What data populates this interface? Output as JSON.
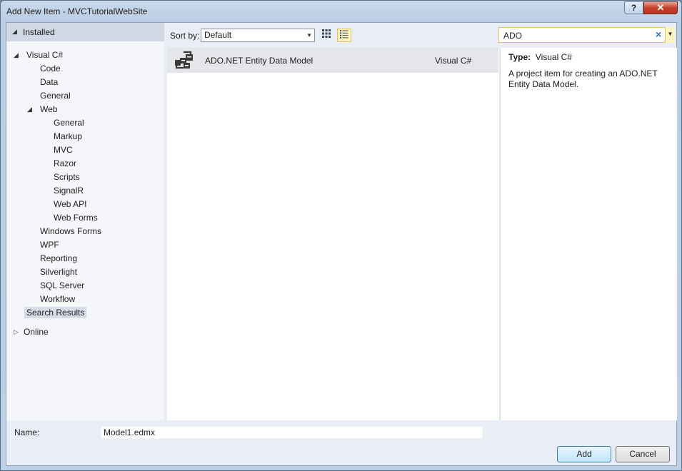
{
  "window": {
    "title": "Add New Item - MVCTutorialWebSite",
    "help_label": "?",
    "close_label": "✕"
  },
  "sidebar": {
    "installed_label": "Installed",
    "tree": [
      {
        "label": "Visual C#",
        "level": 0,
        "expanded": true
      },
      {
        "label": "Code",
        "level": 1
      },
      {
        "label": "Data",
        "level": 1
      },
      {
        "label": "General",
        "level": 1
      },
      {
        "label": "Web",
        "level": 1,
        "expanded": true
      },
      {
        "label": "General",
        "level": 2
      },
      {
        "label": "Markup",
        "level": 2
      },
      {
        "label": "MVC",
        "level": 2
      },
      {
        "label": "Razor",
        "level": 2
      },
      {
        "label": "Scripts",
        "level": 2
      },
      {
        "label": "SignalR",
        "level": 2
      },
      {
        "label": "Web API",
        "level": 2
      },
      {
        "label": "Web Forms",
        "level": 2
      },
      {
        "label": "Windows Forms",
        "level": 1
      },
      {
        "label": "WPF",
        "level": 1
      },
      {
        "label": "Reporting",
        "level": 1
      },
      {
        "label": "Silverlight",
        "level": 1
      },
      {
        "label": "SQL Server",
        "level": 1
      },
      {
        "label": "Workflow",
        "level": 1
      },
      {
        "label": "Search Results",
        "level": 0,
        "selected": true
      }
    ],
    "online_label": "Online"
  },
  "toolbar": {
    "sort_label": "Sort by:",
    "sort_value": "Default",
    "search_value": "ADO"
  },
  "items": [
    {
      "name": "ADO.NET Entity Data Model",
      "language": "Visual C#"
    }
  ],
  "details": {
    "type_label": "Type:",
    "type_value": "Visual C#",
    "description": "A project item for creating an ADO.NET Entity Data Model."
  },
  "footer": {
    "name_label": "Name:",
    "name_value": "Model1.edmx",
    "add_label": "Add",
    "cancel_label": "Cancel"
  },
  "colors": {
    "selected_row": "#e4e6e9",
    "accent_highlight": "#fdf4bf",
    "accent_border": "#e5c365"
  }
}
